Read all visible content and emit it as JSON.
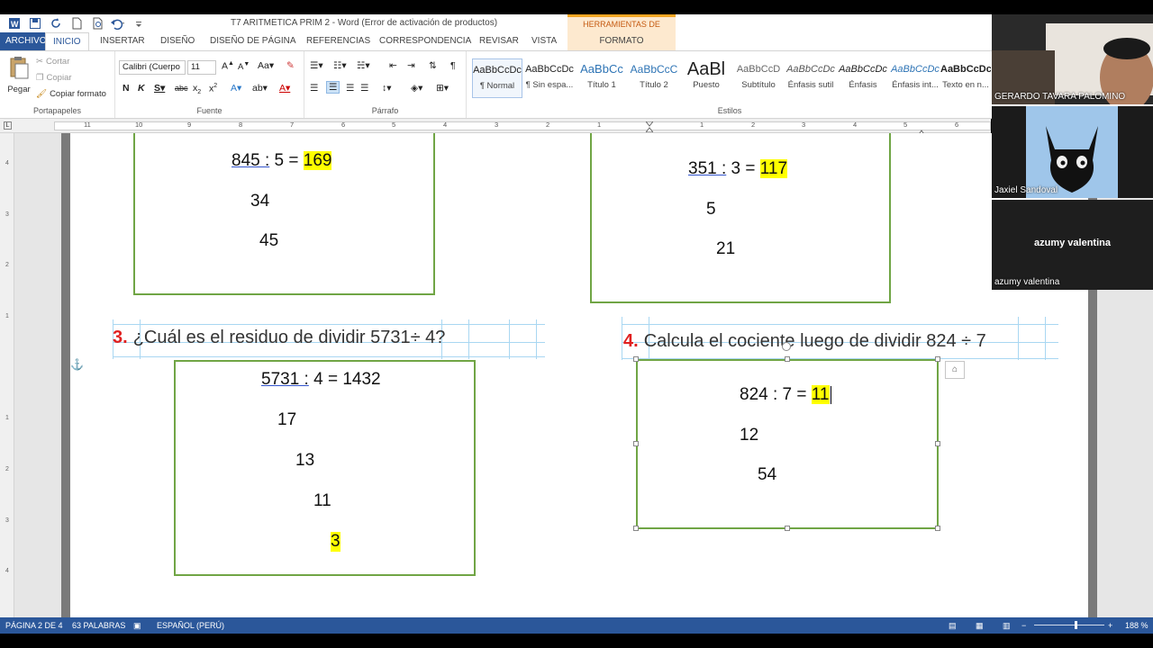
{
  "window": {
    "title": "T7 ARITMETICA PRIM 2 - Word (Error de activación de productos)",
    "context_tab_group": "HERRAMIENTAS DE DIBUJO"
  },
  "tabs": {
    "file": "ARCHIVO",
    "items": [
      "INICIO",
      "INSERTAR",
      "DISEÑO",
      "DISEÑO DE PÁGINA",
      "REFERENCIAS",
      "CORRESPONDENCIA",
      "REVISAR",
      "VISTA"
    ],
    "context": "FORMATO"
  },
  "ribbon": {
    "clipboard": {
      "paste": "Pegar",
      "cut": "Cortar",
      "copy": "Copiar",
      "format_painter": "Copiar formato",
      "label": "Portapapeles"
    },
    "font": {
      "name": "Calibri (Cuerpo",
      "size": "11",
      "label": "Fuente"
    },
    "paragraph": {
      "label": "Párrafo"
    },
    "styles": {
      "label": "Estilos",
      "items": [
        {
          "preview": "AaBbCcDc",
          "name": "¶ Normal"
        },
        {
          "preview": "AaBbCcDc",
          "name": "¶ Sin espa..."
        },
        {
          "preview": "AaBbCc",
          "name": "Título 1"
        },
        {
          "preview": "AaBbCcC",
          "name": "Título 2"
        },
        {
          "preview": "AaBl",
          "name": "Puesto"
        },
        {
          "preview": "AaBbCcD",
          "name": "Subtítulo"
        },
        {
          "preview": "AaBbCcDc",
          "name": "Énfasis sutil"
        },
        {
          "preview": "AaBbCcDc",
          "name": "Énfasis"
        },
        {
          "preview": "AaBbCcDc",
          "name": "Énfasis int..."
        },
        {
          "preview": "AaBbCcDc",
          "name": "Texto en n..."
        }
      ]
    }
  },
  "ruler": {
    "numbers": [
      "11",
      "10",
      "9",
      "8",
      "7",
      "6",
      "5",
      "4",
      "3",
      "2",
      "1",
      "1",
      "2",
      "3",
      "4",
      "5",
      "6"
    ],
    "vertical": [
      "4",
      "3",
      "2",
      "1",
      "1",
      "2",
      "3",
      "4"
    ]
  },
  "document": {
    "box1": {
      "eq_a": "845 :",
      "eq_b": " 5 = ",
      "answer": "169",
      "line2": "34",
      "line3": "45"
    },
    "box2": {
      "eq_a": "351 :",
      "eq_b": " 3 = ",
      "answer": "117",
      "line2": "5",
      "line3": "21"
    },
    "q3": {
      "num": "3.",
      "text": "¿Cuál es el residuo de dividir  5731÷ 4?"
    },
    "q4": {
      "num": "4.",
      "text": "Calcula el cociente luego de dividir 824 ÷ 7"
    },
    "box3": {
      "eq_a": "5731 :",
      "eq_b": " 4 = 1432",
      "line2": "17",
      "line3": "13",
      "line4": "11",
      "answer": "3"
    },
    "box4": {
      "eq": "824 : 7 = ",
      "answer": "11",
      "line2": "12",
      "line3": "54"
    }
  },
  "status": {
    "page": "PÁGINA 2 DE 4",
    "words": "63 PALABRAS",
    "language": "ESPAÑOL (PERÚ)",
    "zoom": "188 %"
  },
  "participants": [
    {
      "name": "GERARDO TAVARA PALOMINO"
    },
    {
      "name": "Jaxiel Sandoval"
    },
    {
      "name": "azumy valentina",
      "center_label": "azumy valentina"
    }
  ]
}
